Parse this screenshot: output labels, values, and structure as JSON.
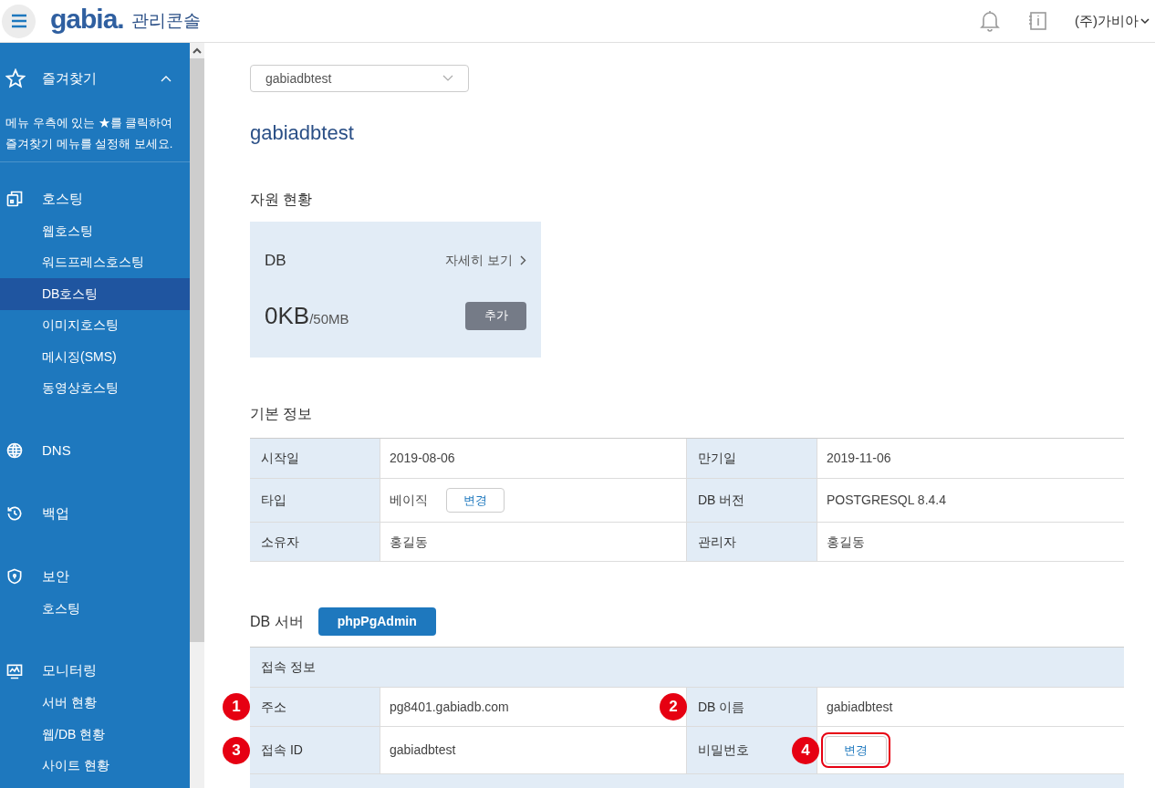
{
  "header": {
    "logo": "gabia.",
    "title": "관리콘솔",
    "account": "(주)가비아"
  },
  "sidebar": {
    "favorites": {
      "label": "즐겨찾기",
      "expanded": true,
      "hint_lines": [
        "메뉴 우측에 있는 ★를 클릭하여",
        "즐겨찾기 메뉴를 설정해 보세요."
      ]
    },
    "groups": [
      {
        "label": "호스팅",
        "children": [
          {
            "label": "웹호스팅",
            "selected": false
          },
          {
            "label": "워드프레스호스팅",
            "selected": false
          },
          {
            "label": "DB호스팅",
            "selected": true
          },
          {
            "label": "이미지호스팅",
            "selected": false
          },
          {
            "label": "메시징(SMS)",
            "selected": false
          },
          {
            "label": "동영상호스팅",
            "selected": false
          }
        ]
      },
      {
        "label": "DNS"
      },
      {
        "label": "백업"
      },
      {
        "label": "보안",
        "children": [
          {
            "label": "호스팅",
            "selected": false
          }
        ]
      },
      {
        "label": "모니터링",
        "children": [
          {
            "label": "서버 현황",
            "selected": false
          },
          {
            "label": "웹/DB 현황",
            "selected": false
          },
          {
            "label": "사이트 현황",
            "selected": false
          }
        ]
      }
    ]
  },
  "service_select": {
    "value": "gabiadbtest"
  },
  "page_title": "gabiadbtest",
  "resources": {
    "title": "자원 현황",
    "card": {
      "name": "DB",
      "link": "자세히 보기",
      "used": "0KB",
      "total": "/50MB",
      "button": "추가"
    }
  },
  "basic_info": {
    "title": "기본 정보",
    "rows": [
      [
        {
          "label": "시작일",
          "value": "2019-08-06"
        },
        {
          "label": "만기일",
          "value": "2019-11-06"
        }
      ],
      [
        {
          "label": "타입",
          "value": "베이직",
          "button": "변경"
        },
        {
          "label": "DB 버전",
          "value": "POSTGRESQL 8.4.4"
        }
      ],
      [
        {
          "label": "소유자",
          "value": "홍길동"
        },
        {
          "label": "관리자",
          "value": "홍길동"
        }
      ]
    ]
  },
  "db_server": {
    "title": "DB 서버",
    "button": "phpPgAdmin",
    "table_header": "접속 정보",
    "rows": [
      [
        {
          "label": "주소",
          "marker": "1",
          "value": "pg8401.gabiadb.com"
        },
        {
          "label": "DB 이름",
          "marker": "2",
          "value": "gabiadbtest"
        }
      ],
      [
        {
          "label": "접속 ID",
          "marker": "3",
          "value": "gabiadbtest"
        },
        {
          "label": "비밀번호",
          "button": "변경",
          "button_marker": "4",
          "highlighted": true
        }
      ]
    ]
  }
}
